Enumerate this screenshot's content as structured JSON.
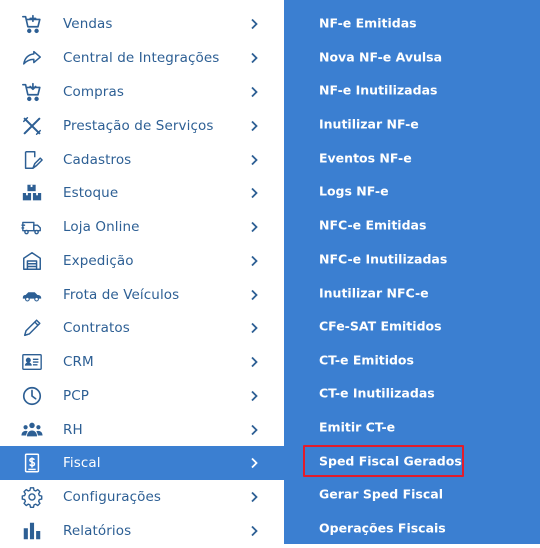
{
  "sidebar": {
    "items": [
      {
        "label": "Vendas",
        "icon": "cart-icon"
      },
      {
        "label": "Central de Integrações",
        "icon": "share-icon"
      },
      {
        "label": "Compras",
        "icon": "cart-icon"
      },
      {
        "label": "Prestação de Serviços",
        "icon": "tools-icon"
      },
      {
        "label": "Cadastros",
        "icon": "edit-icon"
      },
      {
        "label": "Estoque",
        "icon": "boxes-icon"
      },
      {
        "label": "Loja Online",
        "icon": "truck-icon"
      },
      {
        "label": "Expedição",
        "icon": "warehouse-icon"
      },
      {
        "label": "Frota de Veículos",
        "icon": "car-icon"
      },
      {
        "label": "Contratos",
        "icon": "pencil-icon"
      },
      {
        "label": "CRM",
        "icon": "contact-card-icon"
      },
      {
        "label": "PCP",
        "icon": "clock-icon"
      },
      {
        "label": "RH",
        "icon": "users-icon"
      },
      {
        "label": "Fiscal",
        "icon": "fiscal-document-icon",
        "active": true
      },
      {
        "label": "Configurações",
        "icon": "gear-icon"
      },
      {
        "label": "Relatórios",
        "icon": "bar-chart-icon"
      }
    ]
  },
  "submenu": {
    "items": [
      "NF-e Emitidas",
      "Nova NF-e Avulsa",
      "NF-e Inutilizadas",
      "Inutilizar NF-e",
      "Eventos NF-e",
      "Logs NF-e",
      "NFC-e Emitidas",
      "NFC-e Inutilizadas",
      "Inutilizar NFC-e",
      "CFe-SAT Emitidos",
      "CT-e Emitidos",
      "CT-e Inutilizadas",
      "Emitir CT-e",
      "Sped Fiscal Gerados",
      "Gerar Sped Fiscal",
      "Operações Fiscais"
    ],
    "highlighted": "Sped Fiscal Gerados"
  },
  "colors": {
    "accent": "#3b7fd1",
    "label": "#2d5f94",
    "highlight_border": "#e31c2b"
  }
}
